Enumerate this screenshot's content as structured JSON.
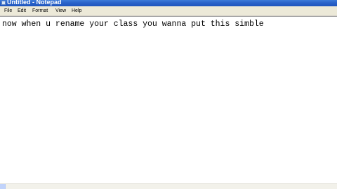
{
  "window": {
    "title": "Untitled - Notepad",
    "app_icon": "notepad-icon"
  },
  "menu": {
    "items": [
      {
        "label": "File"
      },
      {
        "label": "Edit"
      },
      {
        "label": "Format"
      },
      {
        "label": "View"
      },
      {
        "label": "Help"
      }
    ]
  },
  "editor": {
    "text": "now when u rename your class you wanna put this simble"
  },
  "colors": {
    "titlebar": "#2a62c9",
    "menubar": "#ece9d8",
    "editor_bg": "#ffffff"
  }
}
